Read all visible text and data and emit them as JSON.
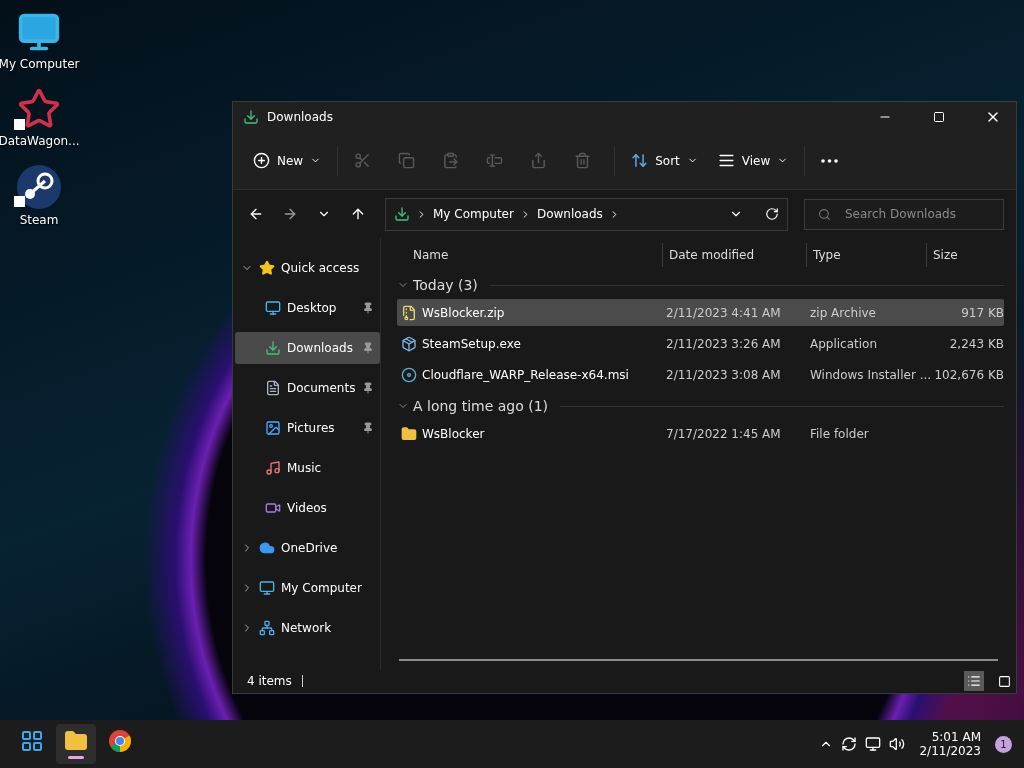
{
  "desktop_icons": [
    {
      "kind": "monitor",
      "label": "My Computer",
      "shortcut": false
    },
    {
      "kind": "star",
      "label": "DataWagon...",
      "shortcut": true
    },
    {
      "kind": "steam",
      "label": "Steam",
      "shortcut": true
    }
  ],
  "window": {
    "title": "Downloads",
    "toolbar": [
      {
        "kind": "new",
        "label": "New",
        "disabled": false
      },
      {
        "kind": "cut",
        "disabled": true
      },
      {
        "kind": "copy",
        "disabled": true
      },
      {
        "kind": "paste",
        "disabled": true
      },
      {
        "kind": "rename",
        "disabled": true
      },
      {
        "kind": "share",
        "disabled": true
      },
      {
        "kind": "delete",
        "disabled": true
      },
      {
        "kind": "sort",
        "label": "Sort",
        "disabled": false
      },
      {
        "kind": "view",
        "label": "View",
        "disabled": false
      },
      {
        "kind": "more",
        "disabled": false
      }
    ],
    "address": {
      "segments": [
        "My Computer",
        "Downloads"
      ]
    },
    "search": {
      "placeholder": "Search Downloads"
    },
    "sidebar": [
      {
        "kind": "star",
        "label": "Quick access",
        "expanded": true,
        "selected": false,
        "children": [
          {
            "kind": "desktop",
            "label": "Desktop",
            "pinned": true,
            "selected": false
          },
          {
            "kind": "download",
            "label": "Downloads",
            "pinned": true,
            "selected": true
          },
          {
            "kind": "document",
            "label": "Documents",
            "pinned": true,
            "selected": false
          },
          {
            "kind": "picture",
            "label": "Pictures",
            "pinned": true,
            "selected": false
          },
          {
            "kind": "music",
            "label": "Music",
            "pinned": false,
            "selected": false
          },
          {
            "kind": "video",
            "label": "Videos",
            "pinned": false,
            "selected": false
          }
        ]
      },
      {
        "kind": "cloud",
        "label": "OneDrive",
        "expanded": false,
        "selected": false
      },
      {
        "kind": "monitor",
        "label": "My Computer",
        "expanded": false,
        "selected": false
      },
      {
        "kind": "network",
        "label": "Network",
        "expanded": false,
        "selected": false
      }
    ],
    "columns": [
      "Name",
      "Date modified",
      "Type",
      "Size"
    ],
    "groups": [
      {
        "title": "Today (3)",
        "expanded": true,
        "files": [
          {
            "kind": "zip",
            "name": "WsBlocker.zip",
            "date": "2/11/2023 4:41 AM",
            "type": "zip Archive",
            "size": "917 KB",
            "selected": true
          },
          {
            "kind": "exe",
            "name": "SteamSetup.exe",
            "date": "2/11/2023 3:26 AM",
            "type": "Application",
            "size": "2,243 KB",
            "selected": false
          },
          {
            "kind": "msi",
            "name": "Cloudflare_WARP_Release-x64.msi",
            "date": "2/11/2023 3:08 AM",
            "type": "Windows Installer ...",
            "size": "102,676 KB",
            "selected": false
          }
        ]
      },
      {
        "title": "A long time ago (1)",
        "expanded": true,
        "files": [
          {
            "kind": "folder",
            "name": "WsBlocker",
            "date": "7/17/2022 1:45 AM",
            "type": "File folder",
            "selected": false
          }
        ]
      }
    ],
    "status": "4 items",
    "view_modes": [
      {
        "kind": "details",
        "selected": true
      },
      {
        "kind": "tiles",
        "selected": false
      }
    ]
  },
  "taskbar": {
    "apps": [
      {
        "kind": "start",
        "selected": false
      },
      {
        "kind": "explorer",
        "selected": true
      },
      {
        "kind": "chrome",
        "selected": false
      }
    ],
    "time": "5:01 AM",
    "date": "2/11/2023",
    "notifications": "1"
  }
}
